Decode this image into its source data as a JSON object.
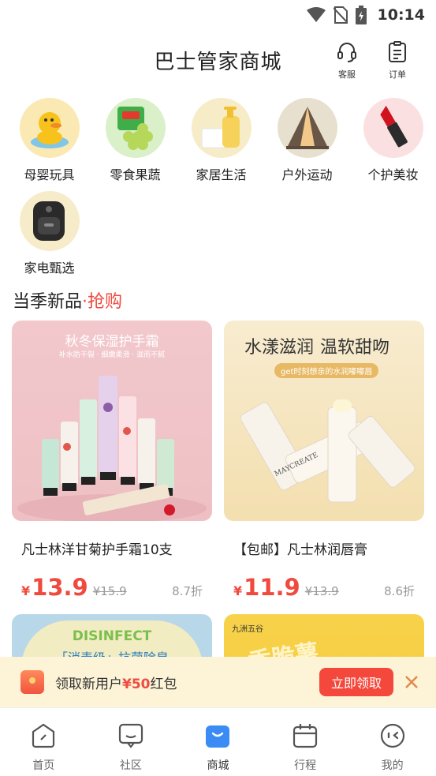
{
  "status_bar": {
    "time": "10:14"
  },
  "header": {
    "title": "巴士管家商城",
    "service_label": "客服",
    "orders_label": "订单"
  },
  "categories": [
    {
      "label": "母婴玩具",
      "icon": "duck-toy-icon"
    },
    {
      "label": "零食果蔬",
      "icon": "snacks-grapes-icon"
    },
    {
      "label": "家居生活",
      "icon": "home-bottle-icon"
    },
    {
      "label": "户外运动",
      "icon": "tent-icon"
    },
    {
      "label": "个护美妆",
      "icon": "lipstick-icon"
    },
    {
      "label": "家电甄选",
      "icon": "air-fryer-icon"
    }
  ],
  "section": {
    "title": "当季新品",
    "dot": "·",
    "accent": "抢购"
  },
  "products": [
    {
      "name": "凡士林洋甘菊护手霜10支",
      "currency": "¥",
      "price": "13.9",
      "original_price": "¥15.9",
      "discount": "8.7折",
      "image_text": {
        "headline": "秋冬保湿护手霜",
        "sub": "补水防干裂 · 细嫩柔滑 · 滋而不腻"
      }
    },
    {
      "name": "【包邮】凡士林润唇膏",
      "currency": "¥",
      "price": "11.9",
      "original_price": "¥13.9",
      "discount": "8.6折",
      "image_text": {
        "headline_a": "水漾滋润",
        "headline_b": "温软甜吻",
        "sub": "get时刻想亲的水润嘟嘟唇",
        "brand": "MAYCREATE"
      }
    },
    {
      "name": "",
      "image_text": {
        "headline": "DISINFECT",
        "sub": "「消毒级」抗菌除臭"
      }
    },
    {
      "name": "",
      "image_text": {
        "headline": "香脆薯",
        "brand": "九洲五谷"
      }
    }
  ],
  "coupon": {
    "text_before": "领取新用户",
    "amount": "¥50",
    "text_after": "红包",
    "button": "立即领取"
  },
  "tabs": [
    {
      "label": "首页",
      "icon": "home-icon"
    },
    {
      "label": "社区",
      "icon": "community-icon"
    },
    {
      "label": "商城",
      "icon": "shop-bag-icon",
      "active": true
    },
    {
      "label": "行程",
      "icon": "trip-calendar-icon"
    },
    {
      "label": "我的",
      "icon": "profile-face-icon"
    }
  ],
  "colors": {
    "accent": "#f04a3f",
    "tab_active": "#3b8bf5",
    "coupon_bg": "#fdf4d8"
  }
}
